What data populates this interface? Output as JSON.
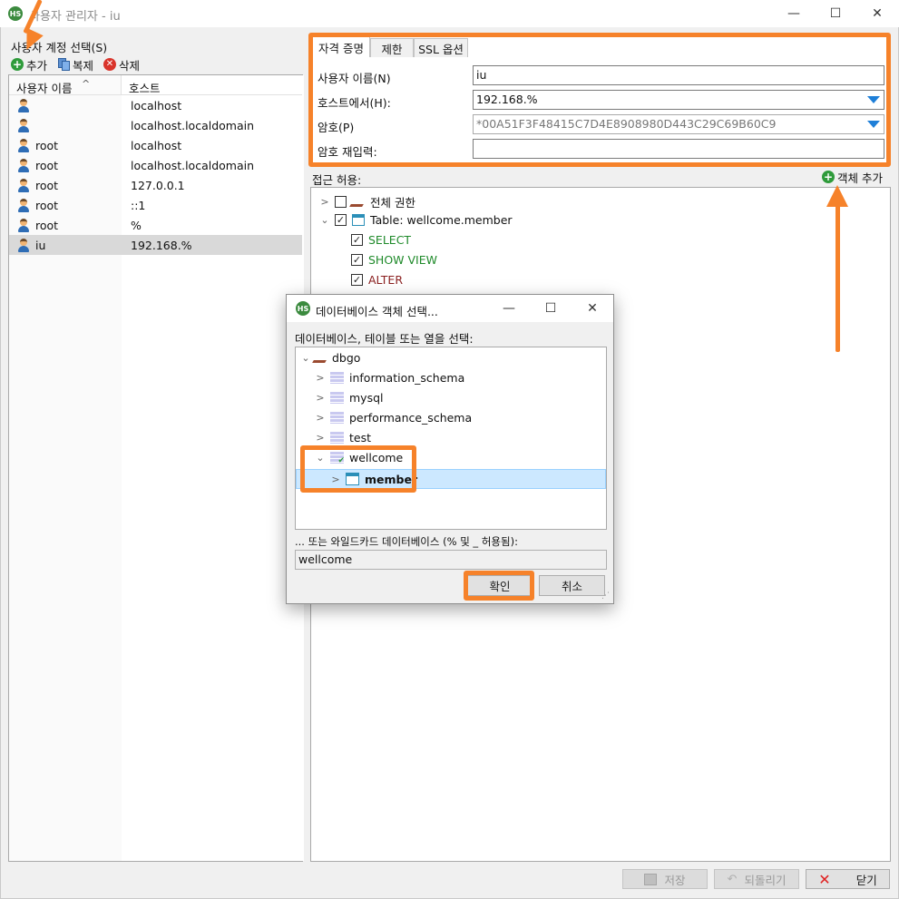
{
  "window": {
    "title": "사용자 관리자 - iu",
    "icon_text": "HS",
    "minimize": "—",
    "maximize": "☐",
    "close": "✕"
  },
  "left": {
    "section_label": "사용자 계정 선택(S)",
    "toolbar": {
      "add": "추가",
      "copy": "복제",
      "delete": "삭제"
    },
    "columns": {
      "user": "사용자 이름",
      "sort": "^",
      "host": "호스트"
    },
    "rows": [
      {
        "user": "",
        "host": "localhost"
      },
      {
        "user": "",
        "host": "localhost.localdomain"
      },
      {
        "user": "root",
        "host": "localhost"
      },
      {
        "user": "root",
        "host": "localhost.localdomain"
      },
      {
        "user": "root",
        "host": "127.0.0.1"
      },
      {
        "user": "root",
        "host": "::1"
      },
      {
        "user": "root",
        "host": "%"
      },
      {
        "user": "iu",
        "host": "192.168.%"
      }
    ]
  },
  "right": {
    "tabs": [
      "자격 증명",
      "제한",
      "SSL 옵션"
    ],
    "credentials": {
      "username_label": "사용자 이름(N)",
      "username_value": "iu",
      "host_label": "호스트에서(H):",
      "host_value": "192.168.%",
      "password_label": "암호(P)",
      "password_value": "*00A51F3F48415C7D4E8908980D443C29C69B60C9",
      "repeat_label": "암호 재입력:",
      "repeat_value": ""
    },
    "access_label": "접근 허용:",
    "add_object": "객체 추가",
    "tree": {
      "all_privileges": "전체 권한",
      "table": "Table: wellcome.member",
      "privs": [
        {
          "label": "SELECT",
          "color": "#1f8a2a"
        },
        {
          "label": "SHOW VIEW",
          "color": "#1f8a2a"
        },
        {
          "label": "ALTER",
          "color": "#8a1f1f"
        }
      ]
    }
  },
  "bottom": {
    "save": "저장",
    "revert": "되돌리기",
    "close": "닫기"
  },
  "dialog": {
    "title": "데이터베이스 객체 선택...",
    "prompt": "데이터베이스, 테이블 또는 열을 선택:",
    "root": "dbgo",
    "items": [
      "information_schema",
      "mysql",
      "performance_schema",
      "test"
    ],
    "expanded": "wellcome",
    "child": "member",
    "wildcard_label": "... 또는 와일드카드 데이터베이스 (% 및 _ 허용됨):",
    "wildcard_value": "wellcome",
    "ok": "확인",
    "cancel": "취소"
  },
  "colors": {
    "highlight": "#f6822a",
    "selection": "#cce8ff",
    "accent": "#1e7fd8"
  }
}
